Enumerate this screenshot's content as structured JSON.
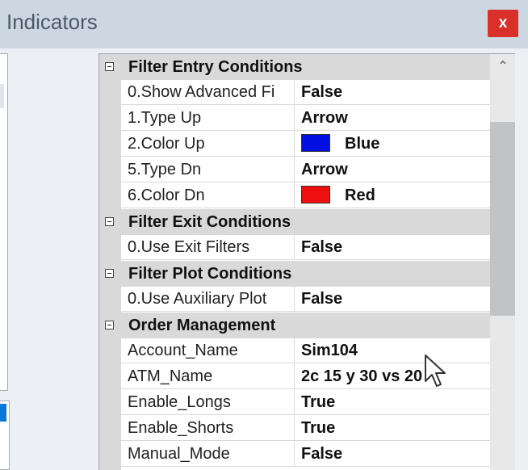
{
  "window": {
    "title": "Indicators",
    "close_glyph": "x"
  },
  "categories": [
    {
      "label": "Filter Entry Conditions",
      "rows": [
        {
          "name": "0.Show Advanced Fi",
          "value": "False"
        },
        {
          "name": "1.Type Up",
          "value": "Arrow"
        },
        {
          "name": "2.Color Up",
          "value": "Blue",
          "swatch": "#0010e0"
        },
        {
          "name": "5.Type Dn",
          "value": "Arrow"
        },
        {
          "name": "6.Color Dn",
          "value": "Red",
          "swatch": "#ee1010"
        }
      ]
    },
    {
      "label": "Filter Exit Conditions",
      "rows": [
        {
          "name": "0.Use Exit Filters",
          "value": "False"
        }
      ]
    },
    {
      "label": "Filter Plot Conditions",
      "rows": [
        {
          "name": "0.Use Auxiliary Plot",
          "value": "False"
        }
      ]
    },
    {
      "label": "Order Management",
      "rows": [
        {
          "name": "Account_Name",
          "value": "Sim104"
        },
        {
          "name": "ATM_Name",
          "value": "2c 15 y 30 vs 20"
        },
        {
          "name": "Enable_Longs",
          "value": "True"
        },
        {
          "name": "Enable_Shorts",
          "value": "True"
        },
        {
          "name": "Manual_Mode",
          "value": "False"
        }
      ]
    }
  ],
  "icons": {
    "expander": "minus-box-icon",
    "scroll_up": "chevron-up-icon",
    "cursor": "mouse-pointer-icon"
  }
}
